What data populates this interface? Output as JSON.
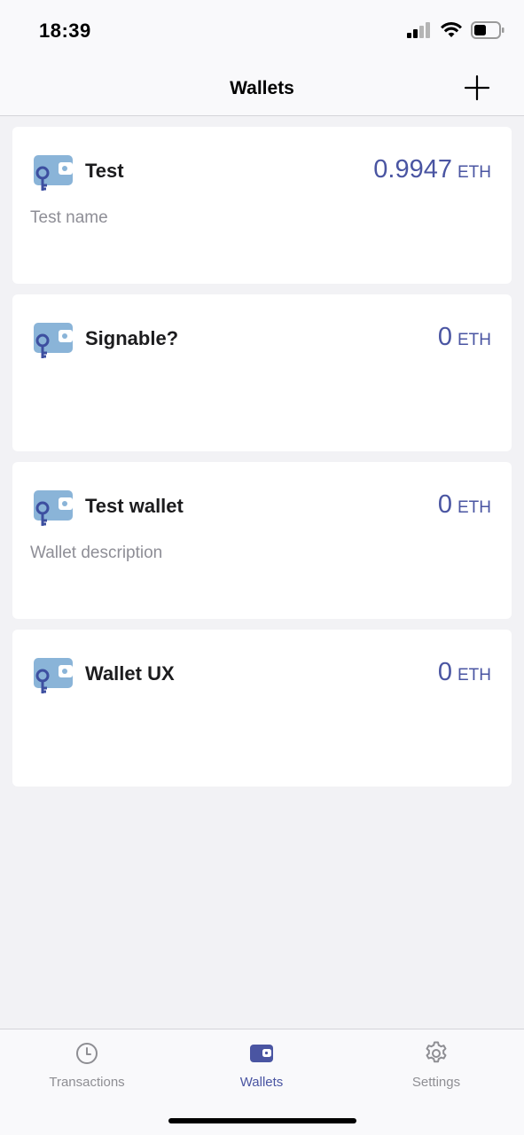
{
  "status_bar": {
    "time": "18:39"
  },
  "nav": {
    "title": "Wallets",
    "add_icon": "plus-icon"
  },
  "wallets": [
    {
      "name": "Test",
      "balance": "0.9947",
      "unit": "ETH",
      "description": "Test name"
    },
    {
      "name": "Signable?",
      "balance": "0",
      "unit": "ETH",
      "description": ""
    },
    {
      "name": "Test wallet",
      "balance": "0",
      "unit": "ETH",
      "description": "Wallet description"
    },
    {
      "name": "Wallet UX",
      "balance": "0",
      "unit": "ETH",
      "description": ""
    }
  ],
  "tabs": [
    {
      "label": "Transactions",
      "icon": "clock-icon",
      "active": false
    },
    {
      "label": "Wallets",
      "icon": "wallet-icon",
      "active": true
    },
    {
      "label": "Settings",
      "icon": "gear-icon",
      "active": false
    }
  ],
  "colors": {
    "accent": "#4a55a2",
    "wallet_icon_bg": "#8ab4d8",
    "key_color": "#3d4fa0"
  }
}
